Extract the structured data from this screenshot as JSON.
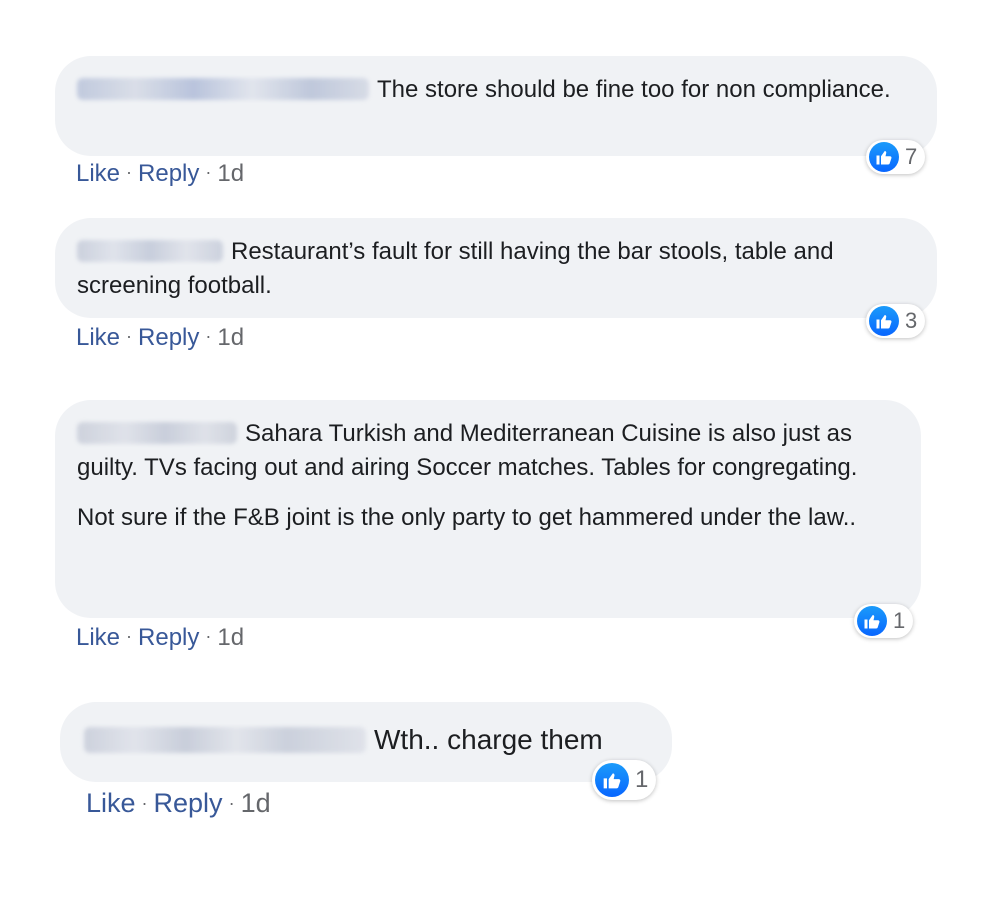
{
  "comments": [
    {
      "paragraphs": [
        "The store should be fine too for non compliance."
      ],
      "like_label": "Like",
      "reply_label": "Reply",
      "timestamp": "1d",
      "reaction_count": "7"
    },
    {
      "paragraphs": [
        "Restaurant’s fault for still having the bar stools, table and screening football."
      ],
      "like_label": "Like",
      "reply_label": "Reply",
      "timestamp": "1d",
      "reaction_count": "3"
    },
    {
      "paragraphs": [
        "Sahara Turkish and Mediterranean Cuisine is also just as guilty. TVs facing out and airing Soccer matches. Tables for congregating.",
        "Not sure if the F&B joint is the only party to get hammered under the law.."
      ],
      "like_label": "Like",
      "reply_label": "Reply",
      "timestamp": "1d",
      "reaction_count": "1"
    },
    {
      "paragraphs": [
        "Wth.. charge them"
      ],
      "like_label": "Like",
      "reply_label": "Reply",
      "timestamp": "1d",
      "reaction_count": "1"
    }
  ],
  "separator": "·",
  "reaction_icon": "thumbs-up-icon",
  "colors": {
    "bubble": "#f0f2f5",
    "link": "#385898",
    "meta": "#65676b",
    "like_blue": "#0866ff"
  }
}
